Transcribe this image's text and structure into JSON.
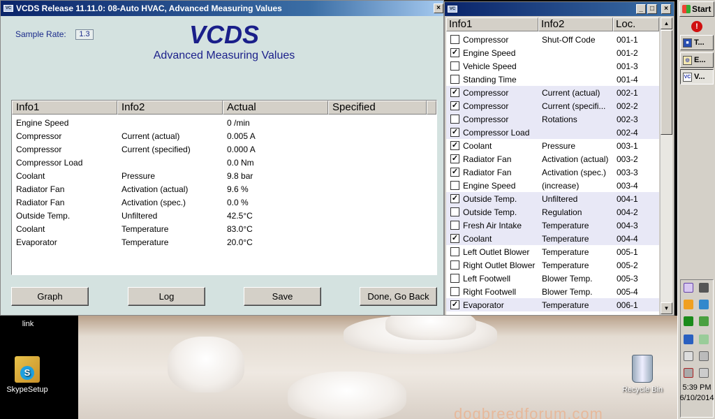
{
  "main_window": {
    "title": "VCDS Release 11.11.0: 08-Auto HVAC,  Advanced Measuring Values",
    "brand": "VCDS",
    "subtitle": "Advanced Measuring Values",
    "sample_rate_label": "Sample Rate:",
    "sample_rate_value": "1.3",
    "columns": [
      "Info1",
      "Info2",
      "Actual",
      "Specified"
    ],
    "rows": [
      {
        "info1": "Engine Speed",
        "info2": "",
        "actual": "0 /min",
        "specified": ""
      },
      {
        "info1": "Compressor",
        "info2": "Current (actual)",
        "actual": "0.005 A",
        "specified": ""
      },
      {
        "info1": "Compressor",
        "info2": "Current (specified)",
        "actual": "0.000 A",
        "specified": ""
      },
      {
        "info1": "Compressor Load",
        "info2": "",
        "actual": "0.0 Nm",
        "specified": ""
      },
      {
        "info1": "Coolant",
        "info2": "Pressure",
        "actual": "9.8 bar",
        "specified": ""
      },
      {
        "info1": "Radiator Fan",
        "info2": "Activation (actual)",
        "actual": "9.6 %",
        "specified": ""
      },
      {
        "info1": "Radiator Fan",
        "info2": "Activation (spec.)",
        "actual": "0.0 %",
        "specified": ""
      },
      {
        "info1": "Outside Temp.",
        "info2": "Unfiltered",
        "actual": "42.5°C",
        "specified": ""
      },
      {
        "info1": "Coolant",
        "info2": "Temperature",
        "actual": "83.0°C",
        "specified": ""
      },
      {
        "info1": "Evaporator",
        "info2": "Temperature",
        "actual": "20.0°C",
        "specified": ""
      }
    ],
    "buttons": {
      "graph": "Graph",
      "log": "Log",
      "save": "Save",
      "done": "Done, Go Back"
    }
  },
  "selection_window": {
    "columns": [
      "Info1",
      "Info2",
      "Loc."
    ],
    "rows": [
      {
        "checked": false,
        "info1": "Compressor",
        "info2": "Shut-Off Code",
        "loc": "001-1",
        "alt": false
      },
      {
        "checked": true,
        "info1": "Engine Speed",
        "info2": "",
        "loc": "001-2",
        "alt": false
      },
      {
        "checked": false,
        "info1": "Vehicle Speed",
        "info2": "",
        "loc": "001-3",
        "alt": false
      },
      {
        "checked": false,
        "info1": "Standing Time",
        "info2": "",
        "loc": "001-4",
        "alt": false
      },
      {
        "checked": true,
        "info1": "Compressor",
        "info2": "Current (actual)",
        "loc": "002-1",
        "alt": true
      },
      {
        "checked": true,
        "info1": "Compressor",
        "info2": "Current (specifi...",
        "loc": "002-2",
        "alt": true
      },
      {
        "checked": false,
        "info1": "Compressor",
        "info2": "Rotations",
        "loc": "002-3",
        "alt": true
      },
      {
        "checked": true,
        "info1": "Compressor Load",
        "info2": "",
        "loc": "002-4",
        "alt": true
      },
      {
        "checked": true,
        "info1": "Coolant",
        "info2": "Pressure",
        "loc": "003-1",
        "alt": false
      },
      {
        "checked": true,
        "info1": "Radiator Fan",
        "info2": "Activation (actual)",
        "loc": "003-2",
        "alt": false
      },
      {
        "checked": true,
        "info1": "Radiator Fan",
        "info2": "Activation (spec.)",
        "loc": "003-3",
        "alt": false
      },
      {
        "checked": false,
        "info1": "Engine Speed",
        "info2": "(increase)",
        "loc": "003-4",
        "alt": false
      },
      {
        "checked": true,
        "info1": "Outside Temp.",
        "info2": "Unfiltered",
        "loc": "004-1",
        "alt": true
      },
      {
        "checked": false,
        "info1": "Outside Temp.",
        "info2": "Regulation",
        "loc": "004-2",
        "alt": true
      },
      {
        "checked": false,
        "info1": "Fresh Air Intake",
        "info2": "Temperature",
        "loc": "004-3",
        "alt": true
      },
      {
        "checked": true,
        "info1": "Coolant",
        "info2": "Temperature",
        "loc": "004-4",
        "alt": true
      },
      {
        "checked": false,
        "info1": "Left Outlet Blower",
        "info2": "Temperature",
        "loc": "005-1",
        "alt": false
      },
      {
        "checked": false,
        "info1": "Right Outlet Blower",
        "info2": "Temperature",
        "loc": "005-2",
        "alt": false
      },
      {
        "checked": false,
        "info1": "Left Footwell",
        "info2": "Blower Temp.",
        "loc": "005-3",
        "alt": false
      },
      {
        "checked": false,
        "info1": "Right Footwell",
        "info2": "Blower Temp.",
        "loc": "005-4",
        "alt": false
      },
      {
        "checked": true,
        "info1": "Evaporator",
        "info2": "Temperature",
        "loc": "006-1",
        "alt": true
      }
    ]
  },
  "taskbar": {
    "start_label": "Start",
    "tasks": [
      {
        "icon": "floppy-icon",
        "label": "T..."
      },
      {
        "icon": "explorer-icon",
        "label": "E..."
      },
      {
        "icon": "vcds-icon",
        "label": "V..."
      }
    ],
    "clock_time": "5:39 PM",
    "clock_date": "6/10/2014"
  },
  "desktop": {
    "icons": [
      {
        "label": "link"
      },
      {
        "label": "SkypeSetup"
      },
      {
        "label": "Recycle Bin"
      }
    ],
    "watermark": "dogbreedforum.com"
  },
  "colors": {
    "title_bar": "#0a246a",
    "window_bg": "#d4e2e0",
    "brand_blue": "#1a1f8a",
    "alt_row": "#e8e8f6"
  }
}
